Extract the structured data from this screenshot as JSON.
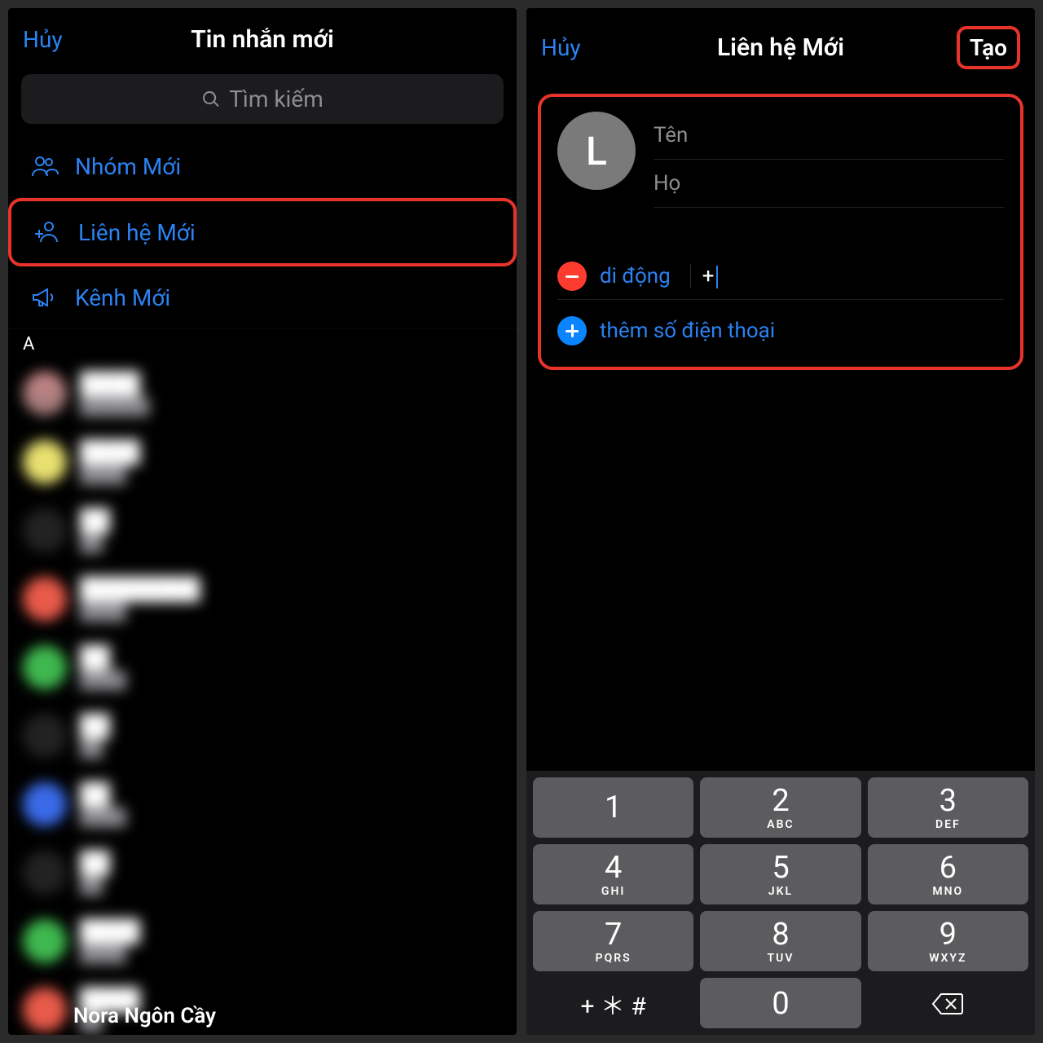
{
  "left": {
    "cancel": "Hủy",
    "title": "Tin nhắn mới",
    "search_placeholder": "Tìm kiếm",
    "options": {
      "new_group": "Nhóm Mới",
      "new_contact": "Liên hệ Mới",
      "new_channel": "Kênh Mới"
    },
    "section_letter": "A",
    "visible_contact": "Nora Ngôn Cầy"
  },
  "right": {
    "cancel": "Hủy",
    "title": "Liên hệ Mới",
    "create": "Tạo",
    "avatar_letter": "L",
    "first_name_placeholder": "Tên",
    "last_name_placeholder": "Họ",
    "phone_type": "di động",
    "phone_value": "+",
    "add_phone": "thêm số điện thoại",
    "keypad": [
      {
        "num": "1",
        "let": ""
      },
      {
        "num": "2",
        "let": "ABC"
      },
      {
        "num": "3",
        "let": "DEF"
      },
      {
        "num": "4",
        "let": "GHI"
      },
      {
        "num": "5",
        "let": "JKL"
      },
      {
        "num": "6",
        "let": "MNO"
      },
      {
        "num": "7",
        "let": "PQRS"
      },
      {
        "num": "8",
        "let": "TUV"
      },
      {
        "num": "9",
        "let": "WXYZ"
      }
    ],
    "symbols": "+ ＊ #",
    "zero": "0"
  }
}
